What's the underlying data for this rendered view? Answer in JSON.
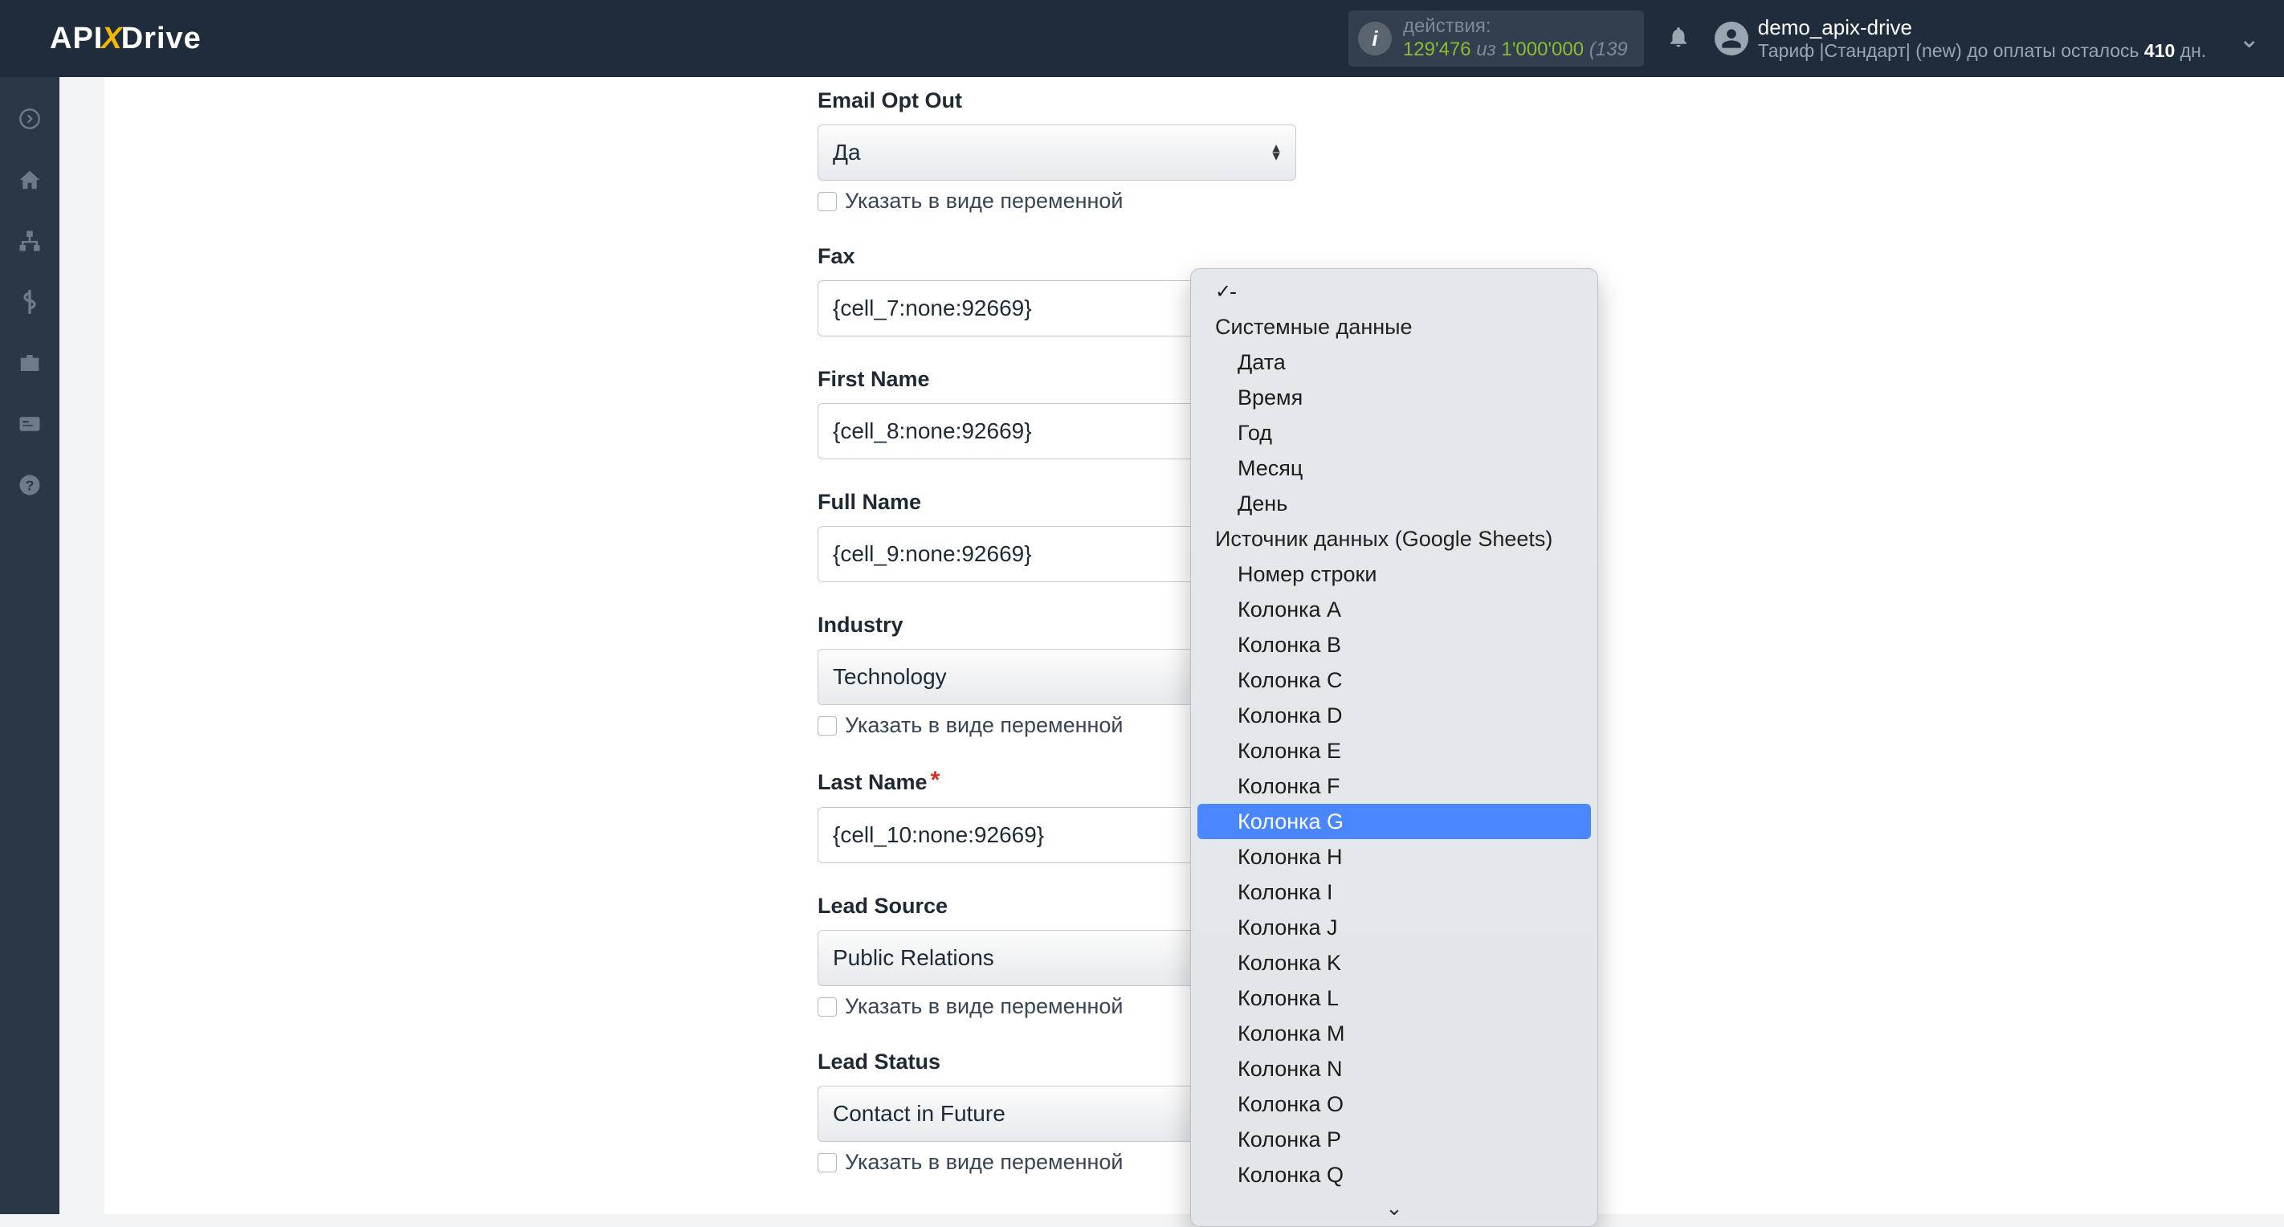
{
  "logo": {
    "pre": "API",
    "mid": "X",
    "post": "Drive"
  },
  "header": {
    "actions_label": "действия:",
    "actions_used": "129'476",
    "actions_of": " из ",
    "actions_total": "1'000'000",
    "actions_open": " (139",
    "username": "demo_apix-drive",
    "tariff_pre": "Тариф |Стандарт| (new) до оплаты осталось ",
    "tariff_days_num": "410",
    "tariff_days_suffix": " дн."
  },
  "form": {
    "email_opt_out": {
      "label": "Email Opt Out",
      "value": "Да",
      "checkbox": "Указать в виде переменной"
    },
    "fax": {
      "label": "Fax",
      "value": "{cell_7:none:92669}"
    },
    "first_name": {
      "label": "First Name",
      "value": "{cell_8:none:92669}"
    },
    "full_name": {
      "label": "Full Name",
      "value": "{cell_9:none:92669}"
    },
    "industry": {
      "label": "Industry",
      "value": "Technology",
      "checkbox": "Указать в виде переменной"
    },
    "last_name": {
      "label": "Last Name",
      "value": "{cell_10:none:92669}"
    },
    "lead_source": {
      "label": "Lead Source",
      "value": "Public Relations",
      "checkbox": "Указать в виде переменной"
    },
    "lead_status": {
      "label": "Lead Status",
      "value": "Contact in Future",
      "checkbox": "Указать в виде переменной"
    }
  },
  "dropdown": {
    "dash": "-",
    "g1": "Системные данные",
    "g1i1": "Дата",
    "g1i2": "Время",
    "g1i3": "Год",
    "g1i4": "Месяц",
    "g1i5": "День",
    "g2": "Источник данных (Google Sheets)",
    "g2i0": "Номер строки",
    "colA": "Колонка A",
    "colB": "Колонка B",
    "colC": "Колонка C",
    "colD": "Колонка D",
    "colE": "Колонка E",
    "colF": "Колонка F",
    "colG": "Колонка G",
    "colH": "Колонка H",
    "colI": "Колонка I",
    "colJ": "Колонка J",
    "colK": "Колонка K",
    "colL": "Колонка L",
    "colM": "Колонка M",
    "colN": "Колонка N",
    "colO": "Колонка O",
    "colP": "Колонка P",
    "colQ": "Колонка Q"
  }
}
